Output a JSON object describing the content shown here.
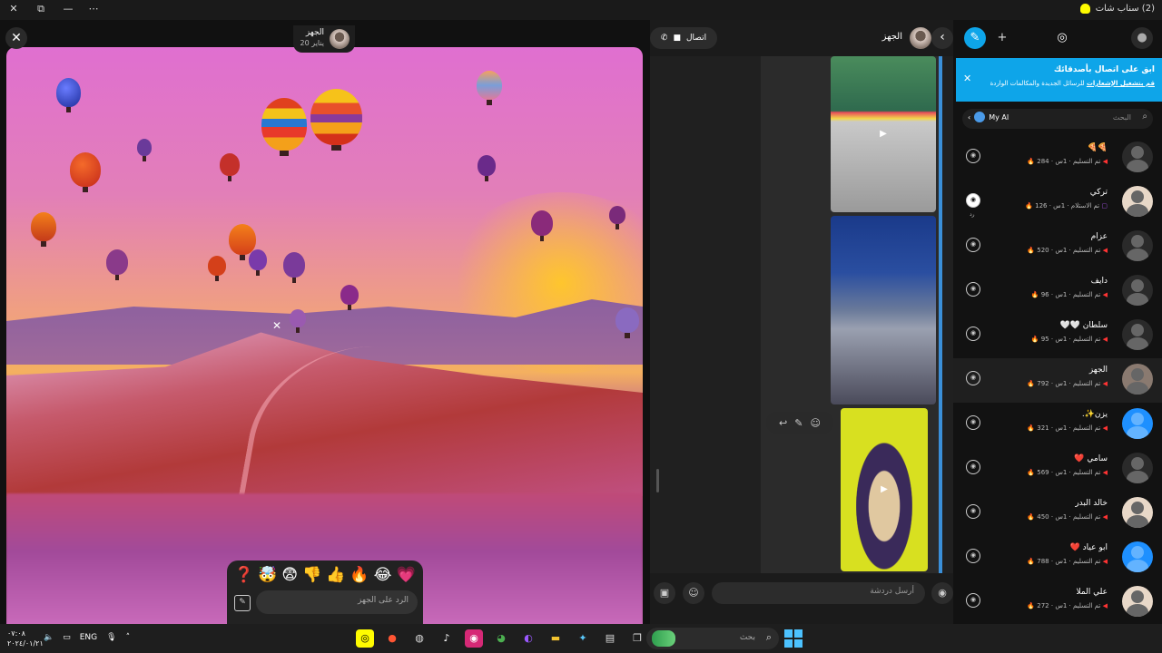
{
  "window": {
    "title": "(2) سناب شات",
    "controls": [
      "✕",
      "⧉",
      "—",
      "⋯"
    ]
  },
  "viewer": {
    "close_icon": "✕",
    "story_owner": "الجهز",
    "story_time": "20 يناير",
    "reactions": [
      "❓",
      "🤯",
      "😨",
      "👎",
      "👍",
      "🔥",
      "😂",
      "💗"
    ],
    "reply_placeholder": "الرد على الجهز"
  },
  "chat": {
    "call_label": "اتصال",
    "contact_name": "الجهز",
    "input_placeholder": "أرسل دردشة",
    "accent_color": "#3a8fd8"
  },
  "sidebar": {
    "banner_title": "ابق على اتصال بأصدقائك",
    "banner_link": "قم بتشغيل الإشعارات",
    "banner_body": "للرسائل الجديدة والمكالمات الواردة",
    "search_placeholder": "البحث",
    "my_ai_label": "My AI",
    "friends": [
      {
        "name": "🍕🍕",
        "status": "تم التسليم",
        "time": "1س",
        "streak": "284",
        "status_icon": "red",
        "underlabel": ""
      },
      {
        "name": "تركي",
        "status": "تم الاستلام",
        "time": "1س",
        "streak": "126",
        "status_icon": "purple",
        "underlabel": "رد"
      },
      {
        "name": "عزام",
        "status": "تم التسليم",
        "time": "1س",
        "streak": "520",
        "status_icon": "red",
        "underlabel": ""
      },
      {
        "name": "دايف",
        "status": "تم التسليم",
        "time": "1س",
        "streak": "96",
        "status_icon": "red",
        "underlabel": ""
      },
      {
        "name": "سلطان 🤍🤍",
        "status": "تم التسليم",
        "time": "1س",
        "streak": "95",
        "status_icon": "red",
        "underlabel": ""
      },
      {
        "name": "الجهز",
        "status": "تم التسليم",
        "time": "1س",
        "streak": "792",
        "status_icon": "red",
        "underlabel": ""
      },
      {
        "name": "يزن✨.",
        "status": "تم التسليم",
        "time": "1س",
        "streak": "321",
        "status_icon": "red",
        "underlabel": ""
      },
      {
        "name": "سامي ❤️",
        "status": "تم التسليم",
        "time": "1س",
        "streak": "569",
        "status_icon": "red",
        "underlabel": ""
      },
      {
        "name": "خالد البدر",
        "status": "تم التسليم",
        "time": "1س",
        "streak": "450",
        "status_icon": "red",
        "underlabel": ""
      },
      {
        "name": "ابو عياد ❤️",
        "status": "تم التسليم",
        "time": "1س",
        "streak": "788",
        "status_icon": "red",
        "underlabel": ""
      },
      {
        "name": "علي الملا",
        "status": "تم التسليم",
        "time": "1س",
        "streak": "272",
        "status_icon": "red",
        "underlabel": ""
      }
    ]
  },
  "taskbar": {
    "time": "٠٧:٠٨",
    "date": "٢٠٢٤/٠١/٢١",
    "language": "ENG",
    "search_placeholder": "بحث"
  }
}
